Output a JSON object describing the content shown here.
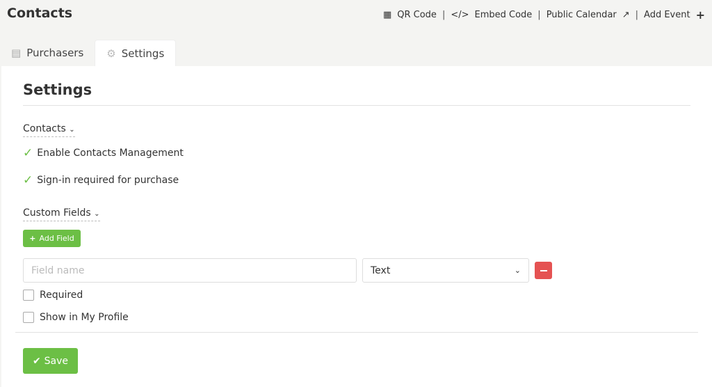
{
  "header": {
    "title": "Contacts",
    "links": [
      {
        "icon": "qr-code-icon",
        "label": "QR Code"
      },
      {
        "icon": "code-icon",
        "label": "Embed Code"
      },
      {
        "icon": "external-link-icon",
        "label": "Public Calendar"
      },
      {
        "icon": "plus-icon",
        "label": "Add Event"
      }
    ],
    "separator": "|"
  },
  "tabs": [
    {
      "icon": "id-card-icon",
      "label": "Purchasers"
    },
    {
      "icon": "gears-icon",
      "label": "Settings",
      "active": true
    }
  ],
  "settings": {
    "title": "Settings",
    "contacts_section": "Contacts",
    "options": [
      "Enable Contacts Management",
      "Sign-in required for purchase"
    ],
    "custom_fields_section": "Custom Fields",
    "add_field": "Add Field",
    "field_name_placeholder": "Field name",
    "field_type": "Text",
    "checkboxes": [
      "Required",
      "Show in My Profile"
    ],
    "save": "Save"
  },
  "colors": {
    "green": "#6cbf45",
    "red": "#e55252"
  }
}
